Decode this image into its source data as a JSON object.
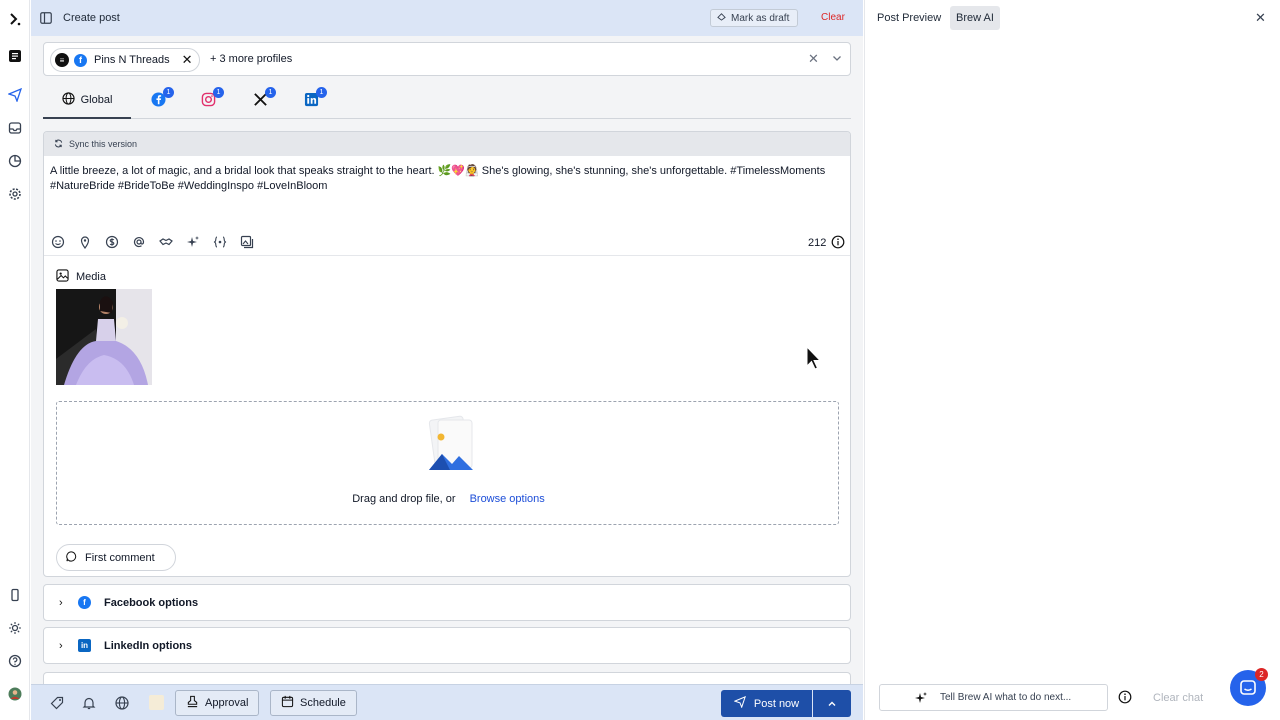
{
  "topbar": {
    "title": "Create post",
    "draft_label": "Mark as draft",
    "clear_label": "Clear"
  },
  "profiles": {
    "chip_name": "Pins N Threads",
    "more": "+ 3 more profiles"
  },
  "tabs": {
    "global_label": "Global",
    "badges": [
      "1",
      "1",
      "1",
      "1"
    ],
    "networks": [
      "facebook-icon",
      "instagram-icon",
      "x-icon",
      "linkedin-icon"
    ]
  },
  "composer": {
    "sync_label": "Sync this version",
    "text": "A little breeze, a lot of magic, and a bridal look that speaks straight to the heart. 🌿💖👰 She's glowing, she's stunning, she's unforgettable. #TimelessMoments #NatureBride #BrideToBe #WeddingInspo #LoveInBloom",
    "char_count": "212",
    "tools": [
      "emoji-icon",
      "location-icon",
      "dollar-icon",
      "mention-icon",
      "handshake-icon",
      "sparkle-icon",
      "variables-icon",
      "media-library-icon"
    ]
  },
  "media": {
    "label": "Media",
    "drop_text": "Drag and drop file, or",
    "browse_label": "Browse options"
  },
  "first_comment": "First comment",
  "accordions": [
    {
      "label": "Facebook options",
      "color": "#1877f2"
    },
    {
      "label": "LinkedIn options",
      "color": "#0a66c2"
    }
  ],
  "bottombar": {
    "approval_label": "Approval",
    "schedule_label": "Schedule",
    "post_now_label": "Post now"
  },
  "right_panel": {
    "tabs": [
      "Post Preview",
      "Brew AI"
    ],
    "ai_placeholder": "Tell Brew AI what to do next...",
    "clear_chat": "Clear chat",
    "chat_badge": "2"
  },
  "colors": {
    "accent": "#1e4fa8",
    "topbar": "#dbe5f6",
    "clear": "#dc2626",
    "link": "#1d4ed8"
  }
}
